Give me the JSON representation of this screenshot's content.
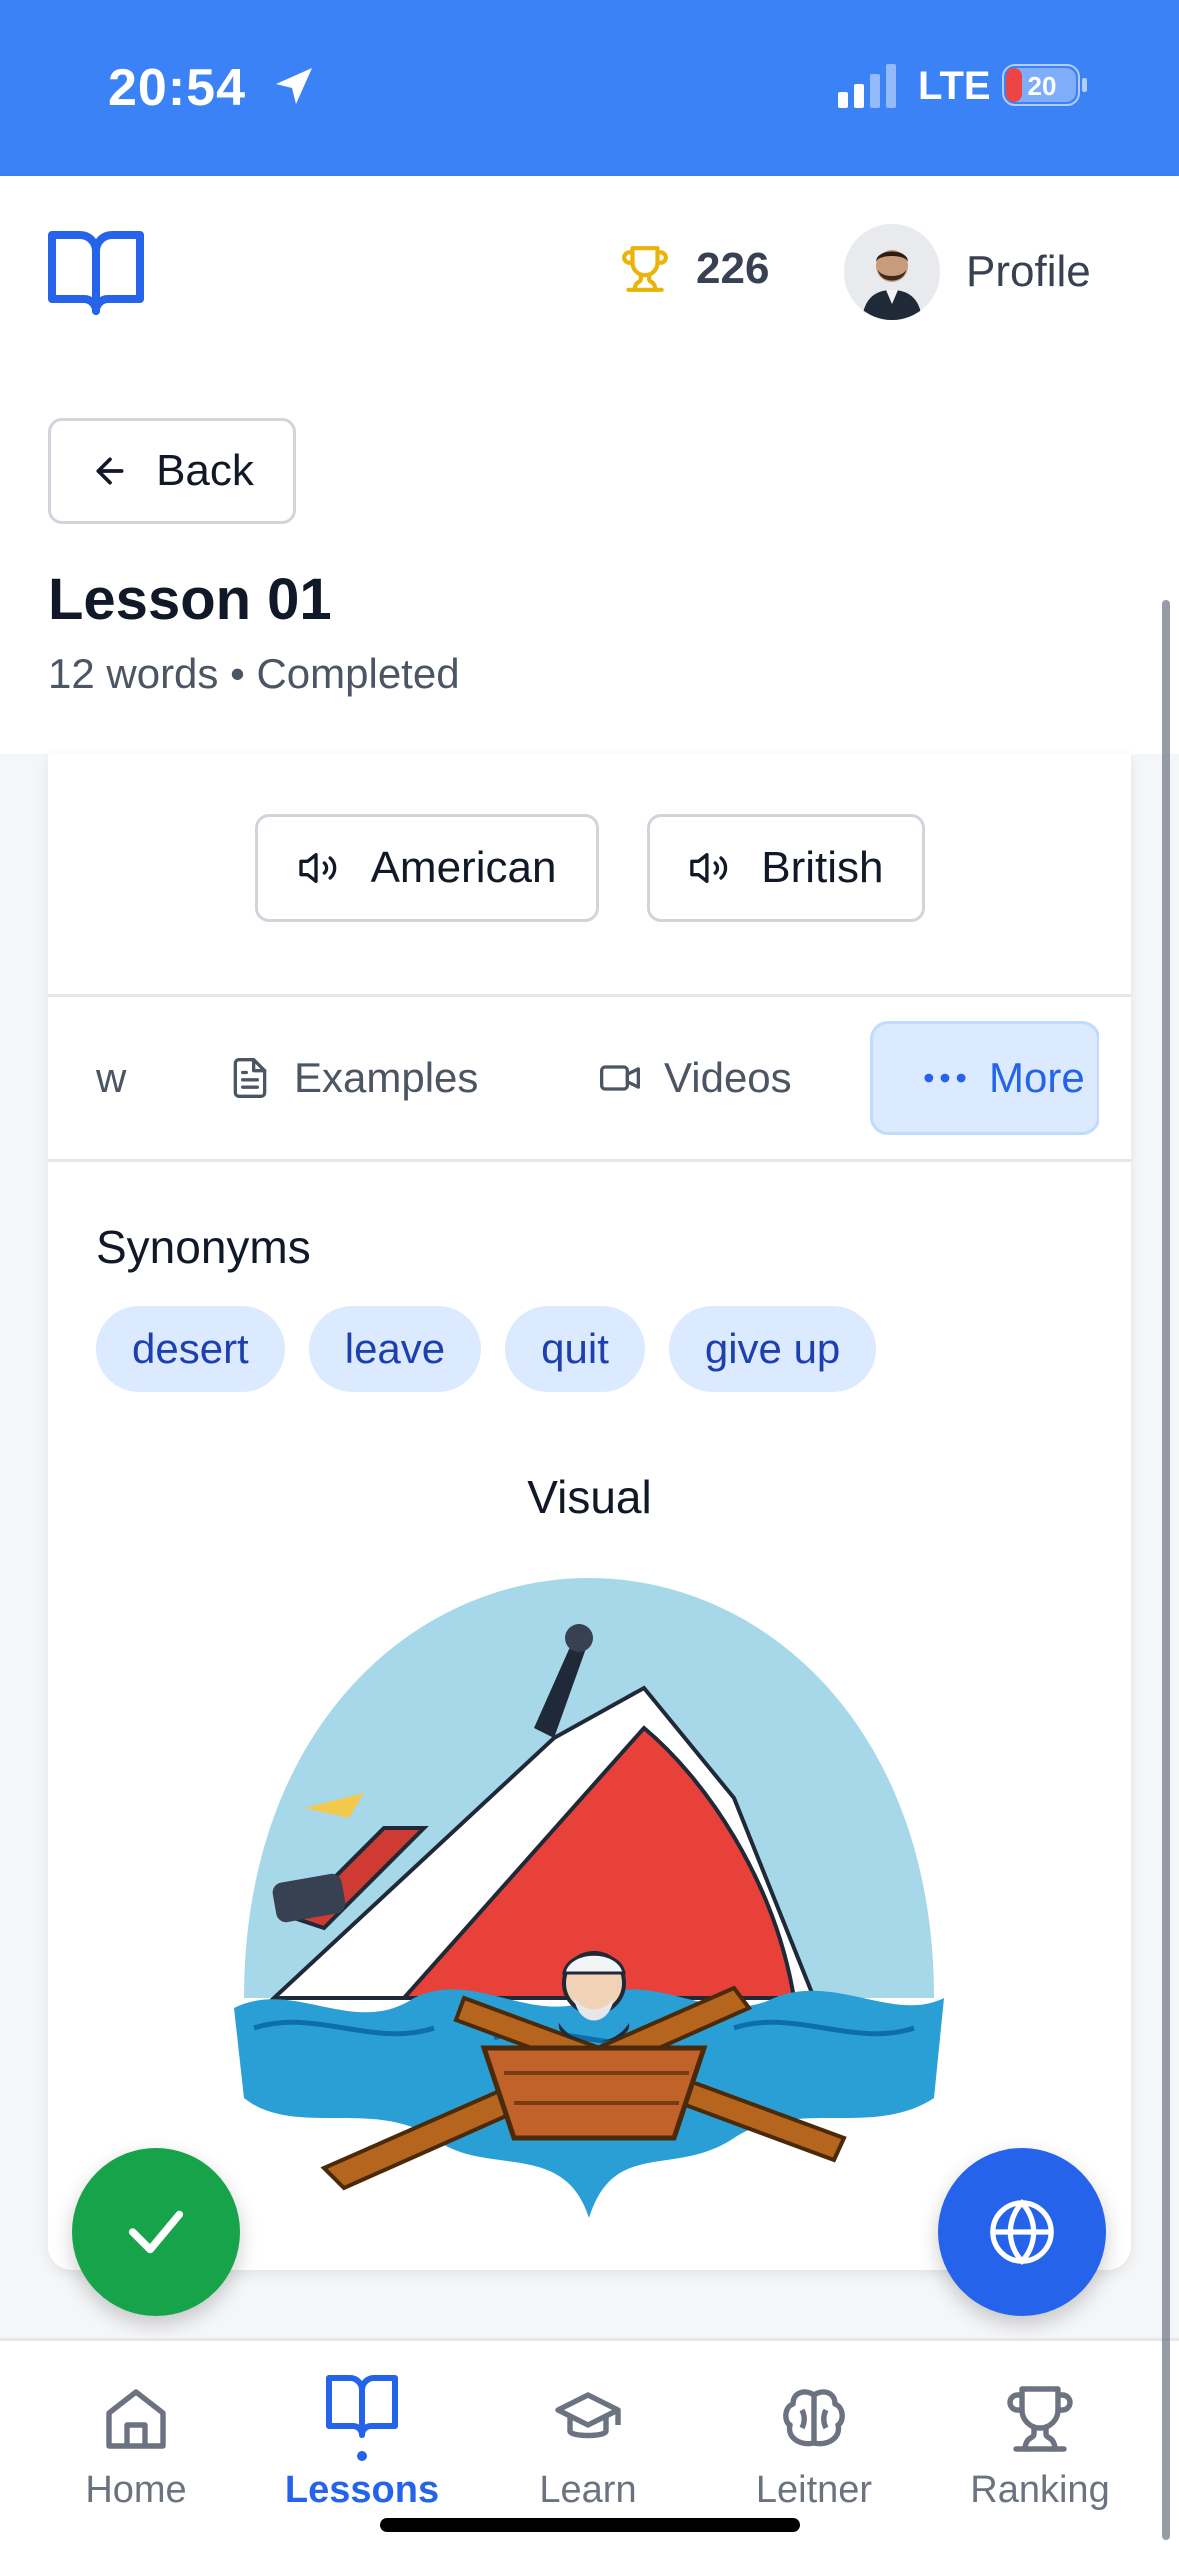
{
  "status_bar": {
    "time": "20:54",
    "network": "LTE",
    "battery": "20"
  },
  "header": {
    "score": "226",
    "profile_label": "Profile"
  },
  "lesson": {
    "back_label": "Back",
    "title": "Lesson 01",
    "meta": "12 words • Completed"
  },
  "pronunciation": {
    "american": "American",
    "british": "British"
  },
  "tabs": {
    "partial": "w",
    "examples": "Examples",
    "videos": "Videos",
    "more": "More"
  },
  "synonyms": {
    "title": "Synonyms",
    "items": [
      "desert",
      "leave",
      "quit",
      "give up"
    ]
  },
  "visual": {
    "title": "Visual"
  },
  "nav": {
    "home": "Home",
    "lessons": "Lessons",
    "learn": "Learn",
    "leitner": "Leitner",
    "ranking": "Ranking"
  },
  "colors": {
    "primary": "#3b82f6",
    "accent": "#2563eb",
    "success": "#16a34a",
    "chip_bg": "#dbeafe"
  }
}
